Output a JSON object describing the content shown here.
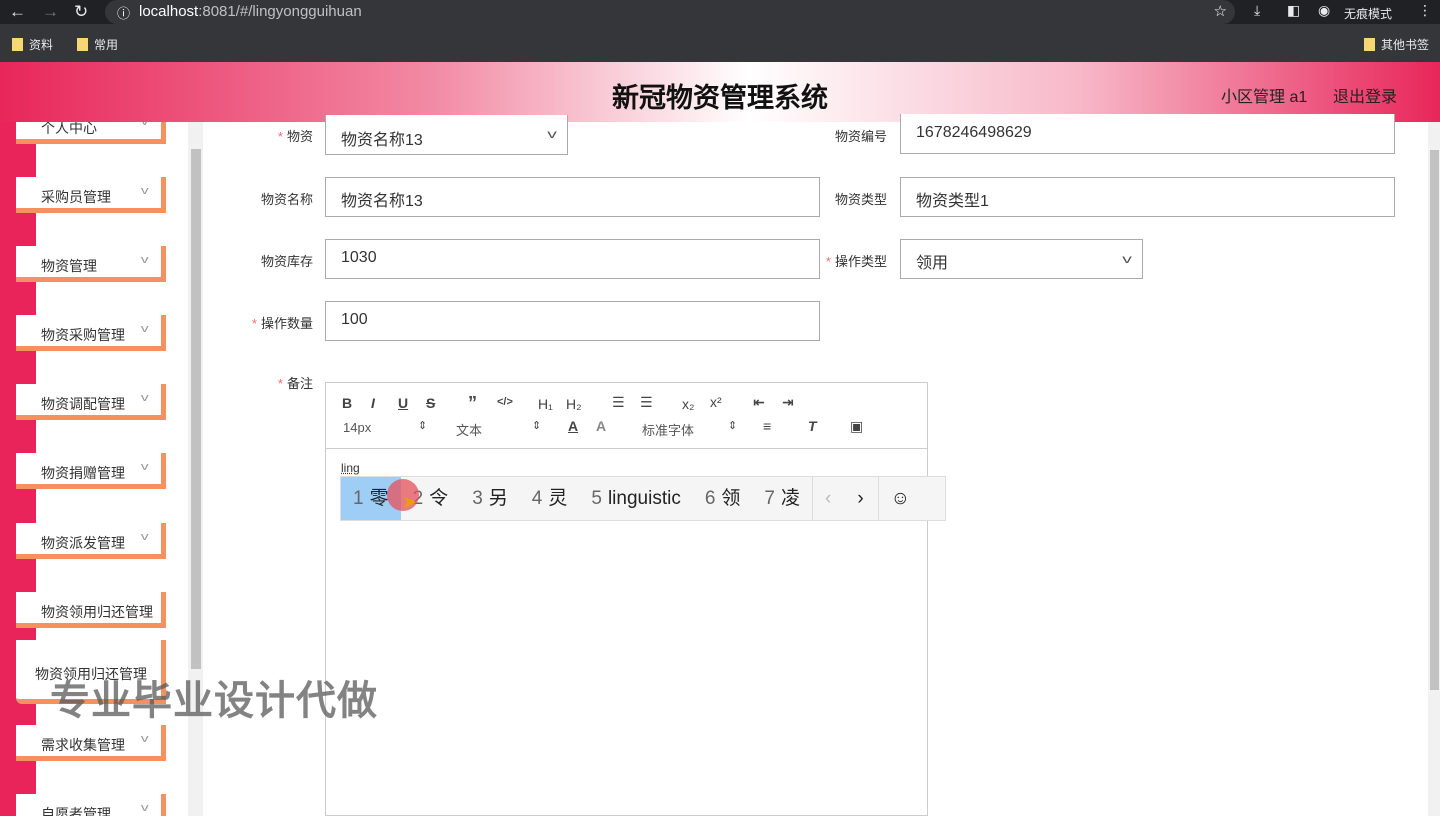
{
  "browser": {
    "url_host": "localhost",
    "url_path": ":8081/#/lingyongguihuan",
    "incognito": "无痕模式",
    "bookmarks": [
      "资料",
      "常用"
    ],
    "other_bookmarks": "其他书签"
  },
  "header": {
    "title": "新冠物资管理系统",
    "user": "小区管理 a1",
    "logout": "退出登录"
  },
  "sidebar": {
    "items": [
      "个人中心",
      "采购员管理",
      "物资管理",
      "物资采购管理",
      "物资调配管理",
      "物资捐赠管理",
      "物资派发管理",
      "物资领用归还管理",
      "物资领用归还管理",
      "需求收集管理",
      "自愿者管理"
    ]
  },
  "form": {
    "wuzi_label": "物资",
    "wuzi_value": "物资名称13",
    "bianhao_label": "物资编号",
    "bianhao_value": "1678246498629",
    "mingcheng_label": "物资名称",
    "mingcheng_value": "物资名称13",
    "leixing_label": "物资类型",
    "leixing_value": "物资类型1",
    "kucun_label": "物资库存",
    "kucun_value": "1030",
    "caozuo_label": "操作类型",
    "caozuo_value": "领用",
    "shuliang_label": "操作数量",
    "shuliang_value": "100",
    "beizhu_label": "备注"
  },
  "editor": {
    "size": "14px",
    "header": "文本",
    "font": "标准字体",
    "content": "ling"
  },
  "ime": {
    "candidates": [
      {
        "n": "1",
        "t": "零"
      },
      {
        "n": "2",
        "t": "令"
      },
      {
        "n": "3",
        "t": "另"
      },
      {
        "n": "4",
        "t": "灵"
      },
      {
        "n": "5",
        "t": "linguistic"
      },
      {
        "n": "6",
        "t": "领"
      },
      {
        "n": "7",
        "t": "凌"
      }
    ]
  },
  "watermark": "专业毕业设计代做"
}
